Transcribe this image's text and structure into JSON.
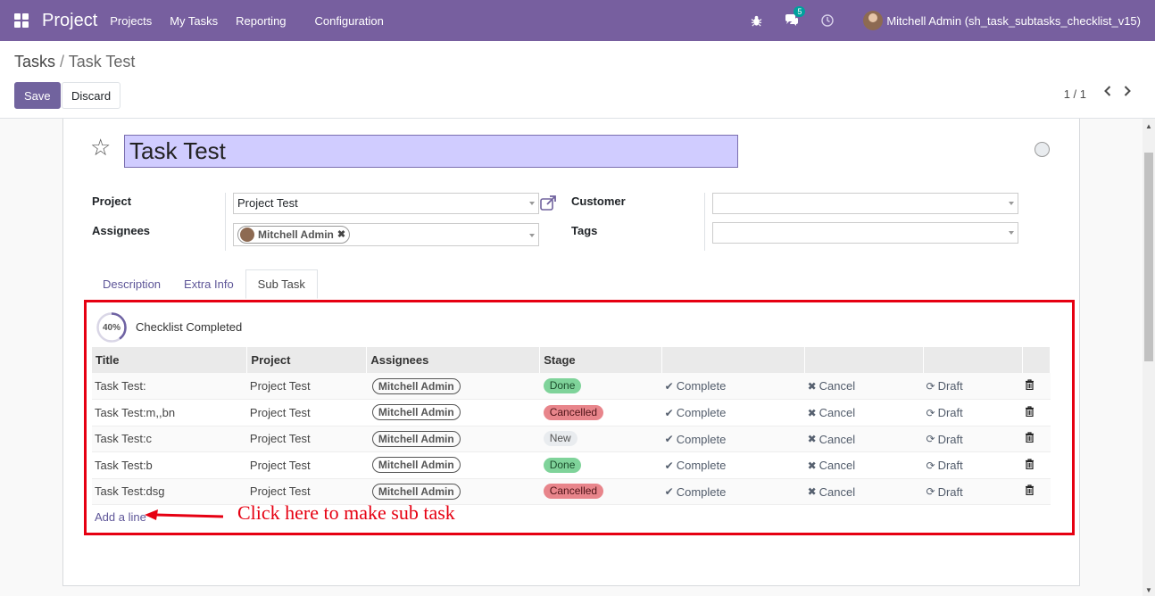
{
  "navbar": {
    "brand": "Project",
    "menu": [
      "Projects",
      "My Tasks",
      "Reporting",
      "Configuration"
    ],
    "chat_count": "5",
    "user": "Mitchell Admin (sh_task_subtasks_checklist_v15)"
  },
  "control": {
    "breadcrumb_parent": "Tasks",
    "breadcrumb_sep": "/",
    "breadcrumb_current": "Task Test",
    "save_label": "Save",
    "discard_label": "Discard",
    "pager": "1 / 1"
  },
  "form": {
    "title": "Task Test",
    "project_label": "Project",
    "project_value": "Project Test",
    "assignees_label": "Assignees",
    "assignee_tag": "Mitchell Admin",
    "customer_label": "Customer",
    "customer_value": "",
    "tags_label": "Tags",
    "tags_value": ""
  },
  "tabs": [
    "Description",
    "Extra Info",
    "Sub Task"
  ],
  "checklist": {
    "progress": "40%",
    "progress_fraction": 0.4,
    "label": "Checklist Completed"
  },
  "subtasks": {
    "headers": [
      "Title",
      "Project",
      "Assignees",
      "Stage",
      "",
      "",
      "",
      ""
    ],
    "rows": [
      {
        "title": "Task Test:",
        "project": "Project Test",
        "assignee": "Mitchell Admin",
        "stage": "Done",
        "stage_type": "done"
      },
      {
        "title": "Task Test:m,,bn",
        "project": "Project Test",
        "assignee": "Mitchell Admin",
        "stage": "Cancelled",
        "stage_type": "cancelled"
      },
      {
        "title": "Task Test:c",
        "project": "Project Test",
        "assignee": "Mitchell Admin",
        "stage": "New",
        "stage_type": "new"
      },
      {
        "title": "Task Test:b",
        "project": "Project Test",
        "assignee": "Mitchell Admin",
        "stage": "Done",
        "stage_type": "done"
      },
      {
        "title": "Task Test:dsg",
        "project": "Project Test",
        "assignee": "Mitchell Admin",
        "stage": "Cancelled",
        "stage_type": "cancelled"
      }
    ],
    "complete_label": "Complete",
    "cancel_label": "Cancel",
    "draft_label": "Draft",
    "add_line": "Add a line"
  },
  "annotation": "Click here to make sub task",
  "colors": {
    "navbar": "#775f9f",
    "primary_button": "#71639e",
    "highlight": "#e60012",
    "done": "#7fd39a",
    "cancelled": "#e8858b"
  }
}
